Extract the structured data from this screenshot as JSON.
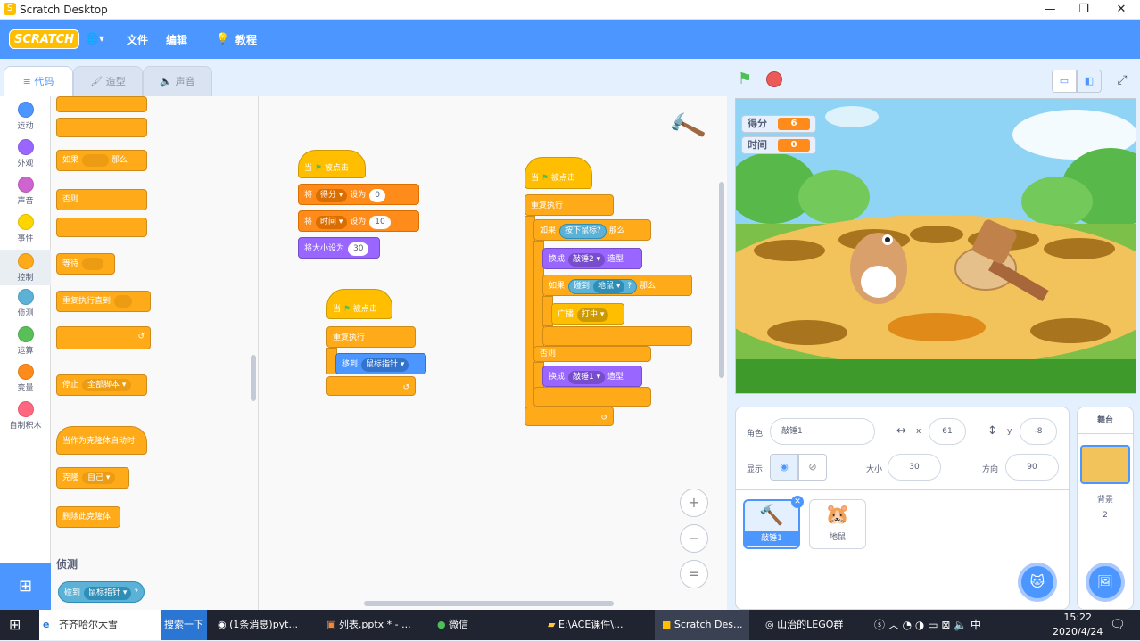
{
  "window": {
    "title": "Scratch Desktop",
    "min": "—",
    "max": "❐",
    "close": "✕"
  },
  "menu": {
    "logo": "SCRATCH",
    "globe": "🌐▾",
    "file": "文件",
    "edit": "编辑",
    "tutorial": "教程"
  },
  "tabs": [
    "代码",
    "造型",
    "声音"
  ],
  "categories": [
    {
      "label": "运动",
      "color": "#4c97ff"
    },
    {
      "label": "外观",
      "color": "#9966ff"
    },
    {
      "label": "声音",
      "color": "#cf63cf"
    },
    {
      "label": "事件",
      "color": "#ffd500"
    },
    {
      "label": "控制",
      "color": "#ffab19"
    },
    {
      "label": "侦测",
      "color": "#5cb1d6"
    },
    {
      "label": "运算",
      "color": "#59c059"
    },
    {
      "label": "变量",
      "color": "#ff8c1a"
    },
    {
      "label": "自制积木",
      "color": "#ff6680"
    }
  ],
  "palette": {
    "if_then": "如果",
    "then": "那么",
    "else": "否则",
    "wait": "等待",
    "repeat_until": "重复执行直到",
    "stop": "停止",
    "stop_opt": "全部脚本 ▾",
    "clone_start": "当作为克隆体启动时",
    "clone": "克隆",
    "clone_opt": "自己 ▾",
    "delete_clone": "删除此克隆体",
    "sensing_title": "侦测",
    "touch": "碰到",
    "touch_opt": "鼠标指针 ▾",
    "q": "?"
  },
  "scripts": {
    "s1": {
      "hat": "当",
      "flag": "被点击",
      "set": "将",
      "var1": "得分 ▾",
      "to": "设为",
      "val1": "0",
      "var2": "时间 ▾",
      "val2": "10",
      "size": "将大小设为",
      "size_val": "30"
    },
    "s2": {
      "hat": "当",
      "flag": "被点击",
      "forever": "重复执行",
      "goto": "移到",
      "target": "鼠标指针 ▾"
    },
    "s3": {
      "hat": "当",
      "flag": "被点击",
      "forever": "重复执行",
      "if": "如果",
      "mouse": "按下鼠标?",
      "then": "那么",
      "switch": "换成",
      "costume2": "敲锤2 ▾",
      "costume_word": "造型",
      "if2": "如果",
      "touch": "碰到",
      "mole": "地鼠 ▾",
      "q": "?",
      "then2": "那么",
      "broadcast": "广播",
      "hit": "打中 ▾",
      "else": "否则",
      "switch2": "换成",
      "costume1": "敲锤1 ▾",
      "costume_word2": "造型"
    }
  },
  "zoom": {
    "in": "+",
    "out": "−",
    "reset": "="
  },
  "stage": {
    "score_label": "得分",
    "score": "6",
    "time_label": "时间",
    "time": "0"
  },
  "sprite": {
    "label": "角色",
    "name": "敲锤1",
    "x_label": "x",
    "x": "61",
    "y_label": "y",
    "y": "-8",
    "show_label": "显示",
    "size_label": "大小",
    "size": "30",
    "dir_label": "方向",
    "dir": "90"
  },
  "sprites": [
    {
      "name": "敲锤1"
    },
    {
      "name": "地鼠"
    }
  ],
  "stage_panel": {
    "title": "舞台",
    "bg_label": "背景",
    "bg_count": "2"
  },
  "taskbar": {
    "search": "齐齐哈尔大雪",
    "search_btn": "搜索一下",
    "chrome": "(1条消息)pyt...",
    "ppt": "列表.pptx * - ...",
    "wechat": "微信",
    "folder": "E:\\ACE课件\\...",
    "scratch": "Scratch Des...",
    "lego": "山治的LEGO群",
    "time": "15:22",
    "date": "2020/4/24"
  }
}
